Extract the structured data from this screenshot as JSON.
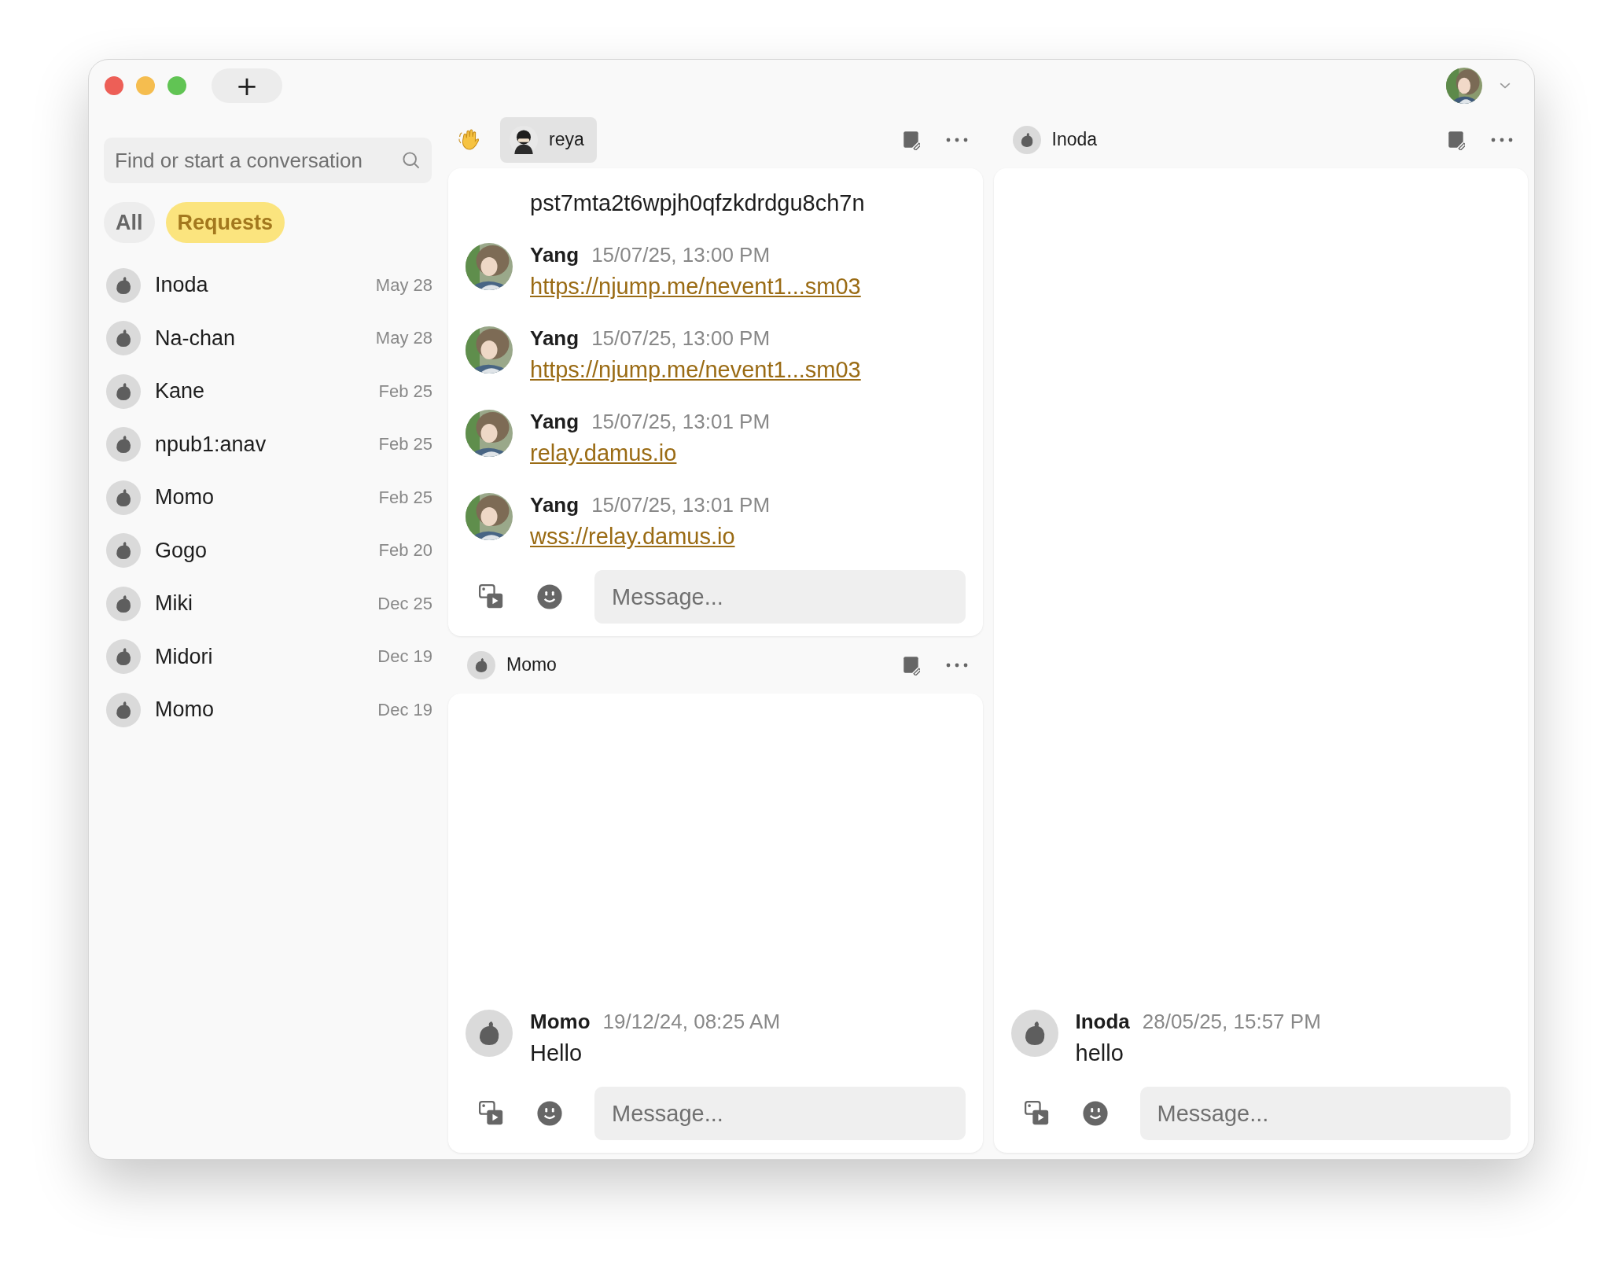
{
  "window": {
    "new_tab": "+"
  },
  "search": {
    "placeholder": "Find or start a conversation"
  },
  "filters": [
    {
      "label": "All",
      "selected": false
    },
    {
      "label": "Requests",
      "selected": true
    }
  ],
  "conversations": [
    {
      "name": "Inoda",
      "date": "May 28"
    },
    {
      "name": "Na-chan",
      "date": "May 28"
    },
    {
      "name": "Kane",
      "date": "Feb 25"
    },
    {
      "name": "npub1:anav",
      "date": "Feb 25"
    },
    {
      "name": "Momo",
      "date": "Feb 25"
    },
    {
      "name": "Gogo",
      "date": "Feb 20"
    },
    {
      "name": "Miki",
      "date": "Dec 25"
    },
    {
      "name": "Midori",
      "date": "Dec 19"
    },
    {
      "name": "Momo",
      "date": "Dec 19"
    }
  ],
  "columns": [
    {
      "panes": [
        {
          "name": "reya",
          "avatar": {
            "kind": "silhouette"
          },
          "selected": true,
          "placeholder": "Message...",
          "messages": [
            {
              "kind": "text",
              "text": "pst7mta2t6wpjh0qfzkdrdgu8ch7n"
            },
            {
              "kind": "link",
              "author": "Yang",
              "time": "15/07/25, 13:00 PM",
              "text": "https://njump.me/nevent1...sm03"
            },
            {
              "kind": "link",
              "author": "Yang",
              "time": "15/07/25, 13:00 PM",
              "text": "https://njump.me/nevent1...sm03"
            },
            {
              "kind": "link",
              "author": "Yang",
              "time": "15/07/25, 13:01 PM",
              "text": "relay.damus.io"
            },
            {
              "kind": "link",
              "author": "Yang",
              "time": "15/07/25, 13:01 PM",
              "text": "wss://relay.damus.io"
            }
          ]
        },
        {
          "name": "Momo",
          "avatar": {
            "kind": "default"
          },
          "selected": false,
          "placeholder": "Message...",
          "messages": [
            {
              "kind": "text",
              "author": "Momo",
              "avatar": {
                "kind": "default"
              },
              "time": "19/12/24, 08:25 AM",
              "text": "Hello"
            }
          ]
        }
      ]
    },
    {
      "panes": [
        {
          "name": "Inoda",
          "avatar": {
            "kind": "default"
          },
          "selected": false,
          "placeholder": "Message...",
          "messages": [
            {
              "kind": "text",
              "author": "Inoda",
              "avatar": {
                "kind": "default"
              },
              "time": "28/05/25, 15:57 PM",
              "text": "hello"
            }
          ]
        }
      ]
    }
  ]
}
